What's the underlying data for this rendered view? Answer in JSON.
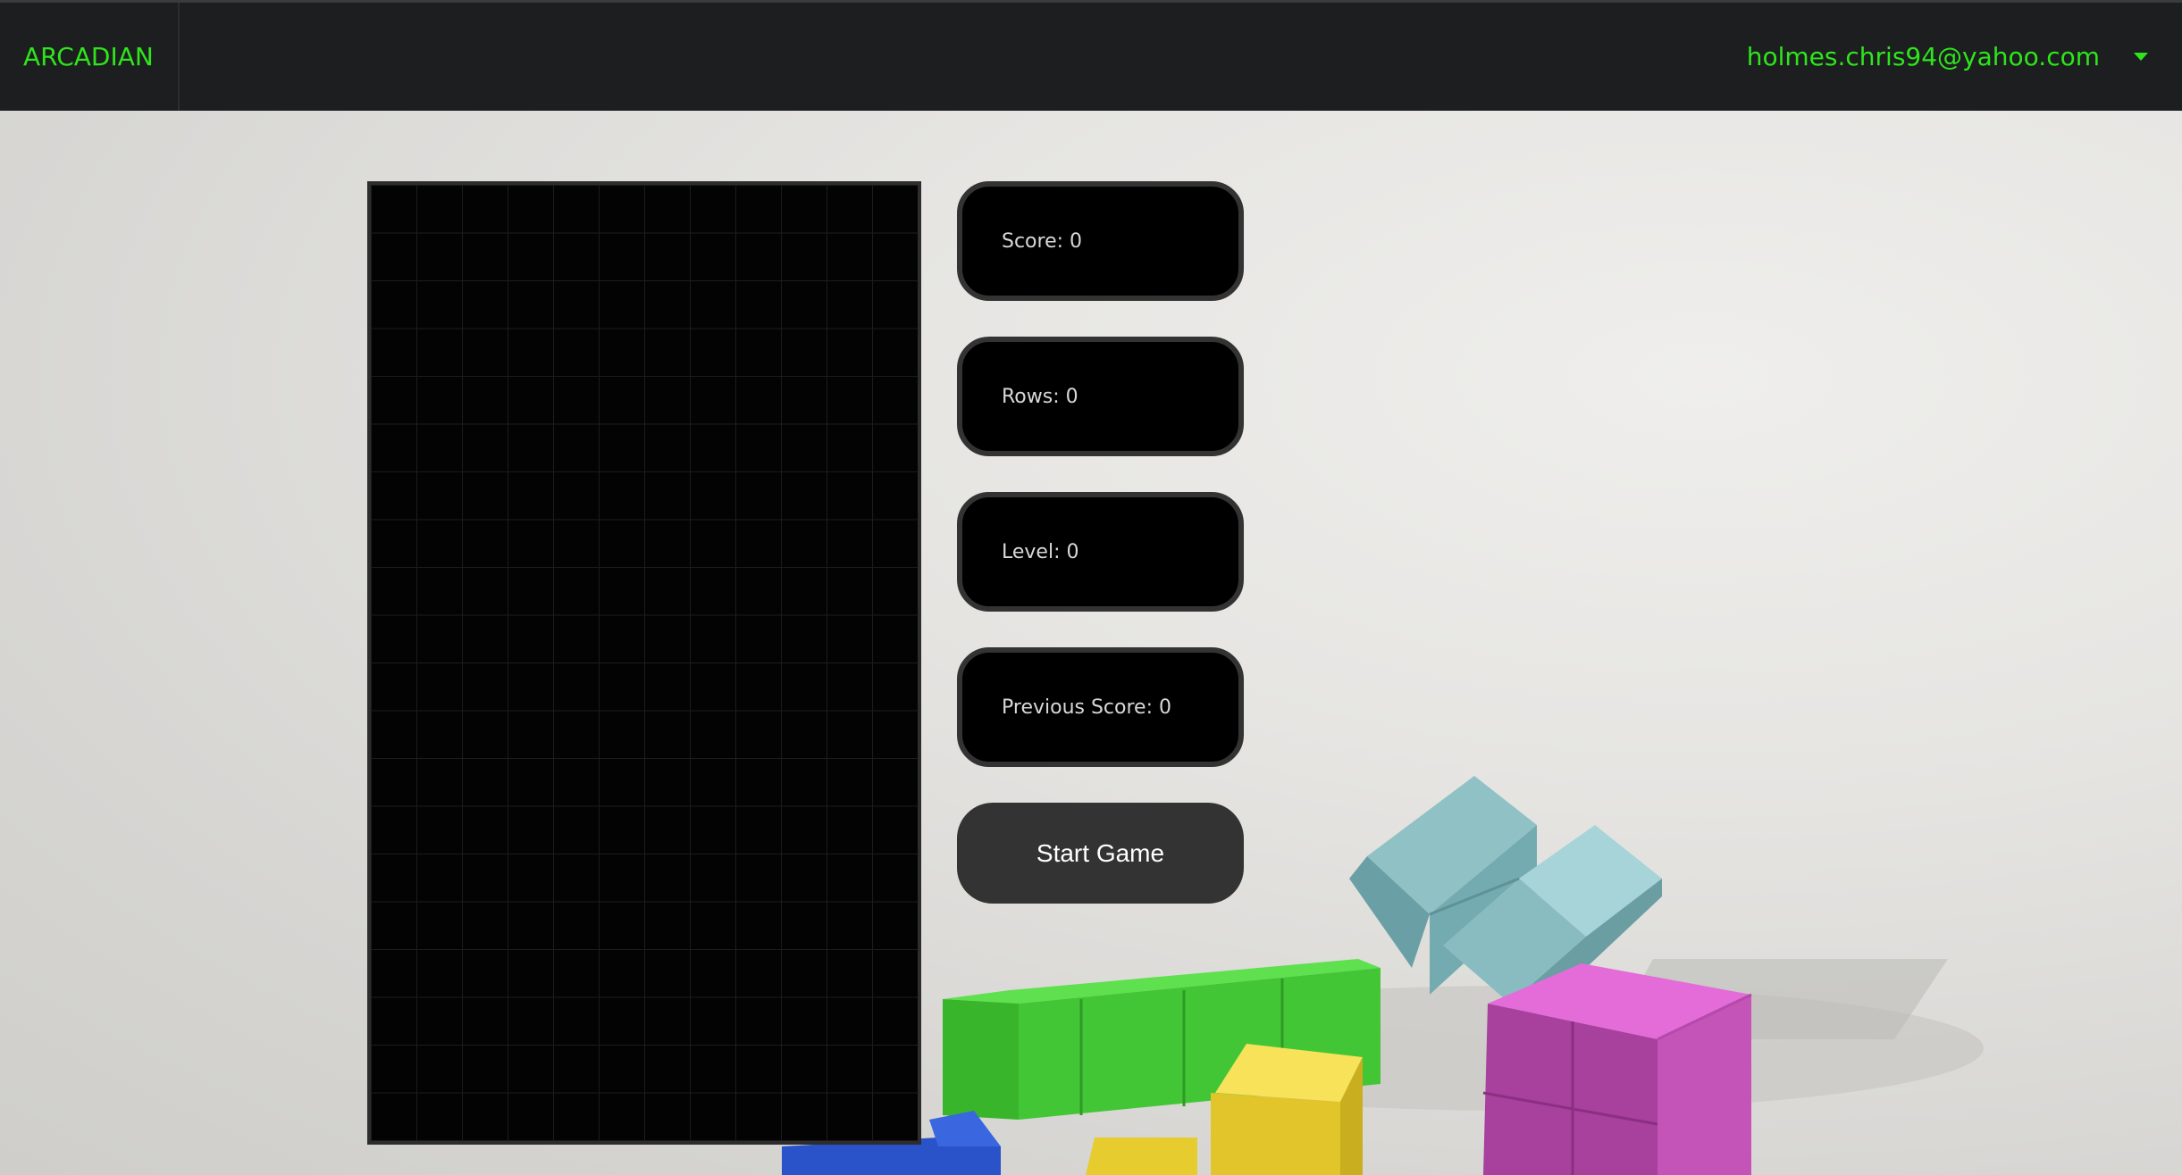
{
  "navbar": {
    "brand": "ARCADIAN",
    "user_email": "holmes.chris94@yahoo.com",
    "menu_icon": "caret-down-icon"
  },
  "game": {
    "board": {
      "columns": 12,
      "rows": 20,
      "background": "#030303"
    },
    "stats": [
      {
        "name": "score",
        "label": "Score",
        "value": "0"
      },
      {
        "name": "rows",
        "label": "Rows",
        "value": "0"
      },
      {
        "name": "level",
        "label": "Level",
        "value": "0"
      },
      {
        "name": "previous-score",
        "label": "Previous Score",
        "value": "0"
      }
    ],
    "start_button": "Start Game"
  },
  "colors": {
    "accent": "#2ee51c",
    "navbar_bg": "#1d1e20",
    "panel_bg": "#000000",
    "button_bg": "#333333"
  }
}
